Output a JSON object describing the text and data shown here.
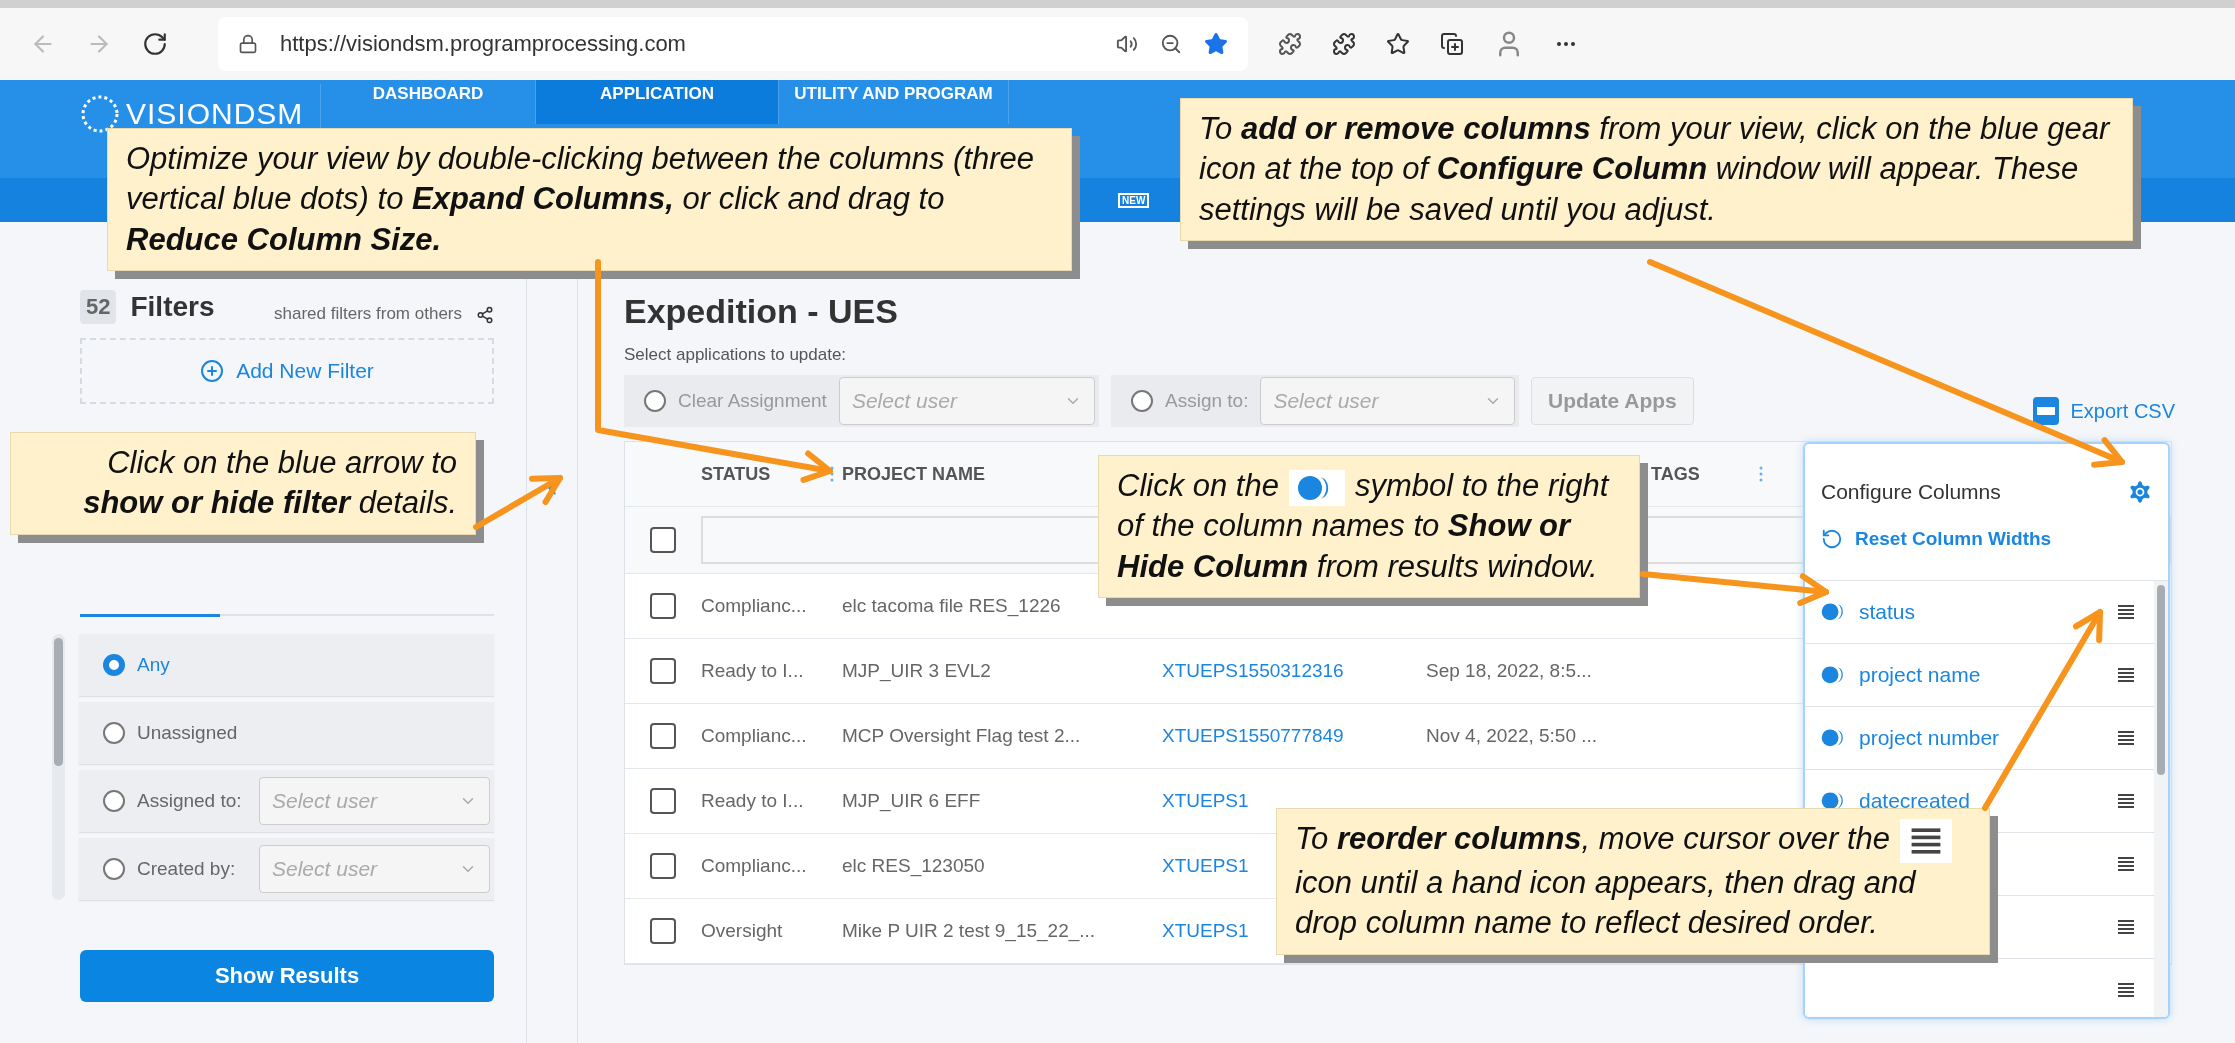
{
  "browser": {
    "url": "https://visiondsm.programprocessing.com"
  },
  "header": {
    "logo": "VISIONDSM",
    "nav": [
      {
        "label": "DASHBOARD",
        "selected": false
      },
      {
        "label": "APPLICATION",
        "selected": true
      },
      {
        "label": "UTILITY AND PROGRAM",
        "selected": false
      }
    ],
    "new_badge": "NEW"
  },
  "sidebar": {
    "count": "52",
    "title": "Filters",
    "shared_link": "shared filters from others",
    "add_filter": "Add New Filter",
    "assignment_options": [
      {
        "label": "Any",
        "selected": true
      },
      {
        "label": "Unassigned",
        "selected": false
      },
      {
        "label": "Assigned to:",
        "selected": false,
        "placeholder": "Select user"
      },
      {
        "label": "Created by:",
        "selected": false,
        "placeholder": "Select user"
      }
    ],
    "show_results": "Show Results"
  },
  "main": {
    "title": "Expedition - UES",
    "update_label": "Select applications to update:",
    "actions": [
      {
        "label": "Clear Assignment",
        "selected": false,
        "placeholder": "Select user"
      },
      {
        "label": "Assign to:",
        "selected": false,
        "placeholder": "Select user"
      }
    ],
    "update_button": "Update Apps",
    "export": "Export CSV"
  },
  "table": {
    "columns": [
      {
        "label": "STATUS"
      },
      {
        "label": "PROJECT NAME"
      },
      {
        "label": "TAGS"
      }
    ],
    "select_all_checked": false,
    "rows": [
      {
        "checked": false,
        "cells": [
          "Complianc...",
          "elc tacoma file RES_1226"
        ]
      },
      {
        "checked": false,
        "cells": [
          "Ready to I...",
          "MJP_UIR 3 EVL2",
          "XTUEPS1550312316",
          "Sep 18, 2022, 8:5..."
        ]
      },
      {
        "checked": false,
        "cells": [
          "Complianc...",
          "MCP Oversight Flag test 2...",
          "XTUEPS1550777849",
          "Nov 4, 2022, 5:50 ..."
        ]
      },
      {
        "checked": false,
        "cells": [
          "Ready to I...",
          "MJP_UIR 6 EFF",
          "XTUEPS1"
        ]
      },
      {
        "checked": false,
        "cells": [
          "Complianc...",
          "elc RES_123050",
          "XTUEPS1"
        ]
      },
      {
        "checked": false,
        "cells": [
          "Oversight",
          "Mike P UIR 2 test 9_15_22_...",
          "XTUEPS1"
        ]
      }
    ]
  },
  "configure_columns": {
    "title": "Configure Columns",
    "reset": "Reset Column Widths",
    "items": [
      {
        "kind": "labelled",
        "label": "status"
      },
      {
        "kind": "labelled",
        "label": "project name"
      },
      {
        "kind": "labelled",
        "label": "project number"
      },
      {
        "kind": "labelled",
        "label": "datecreated"
      },
      {
        "kind": "covered"
      },
      {
        "kind": "covered"
      },
      {
        "kind": "covered"
      }
    ]
  },
  "callouts": [
    {
      "kind": "text",
      "text": "Optimize your view by double-clicking between the columns (three vertical blue dots) to **Expand Columns,** or click and drag to **Reduce Column Size.**"
    },
    {
      "kind": "text",
      "text": "To **add or remove columns** from your view, click on the blue gear icon  at the top of **Configure Column** window will appear.  These settings will be saved until you adjust."
    },
    {
      "kind": "text",
      "text": "Click on the blue arrow to **show or hide filter** details."
    },
    {
      "kind": "toggle",
      "before": "Click on the",
      "after": "symbol to the right of the column names to **Show or Hide Column** from results window."
    },
    {
      "kind": "handle",
      "before": "To **reorder columns**, move cursor over the",
      "after": "icon until a hand icon appears, then drag and drop column name to reflect desired order."
    }
  ]
}
